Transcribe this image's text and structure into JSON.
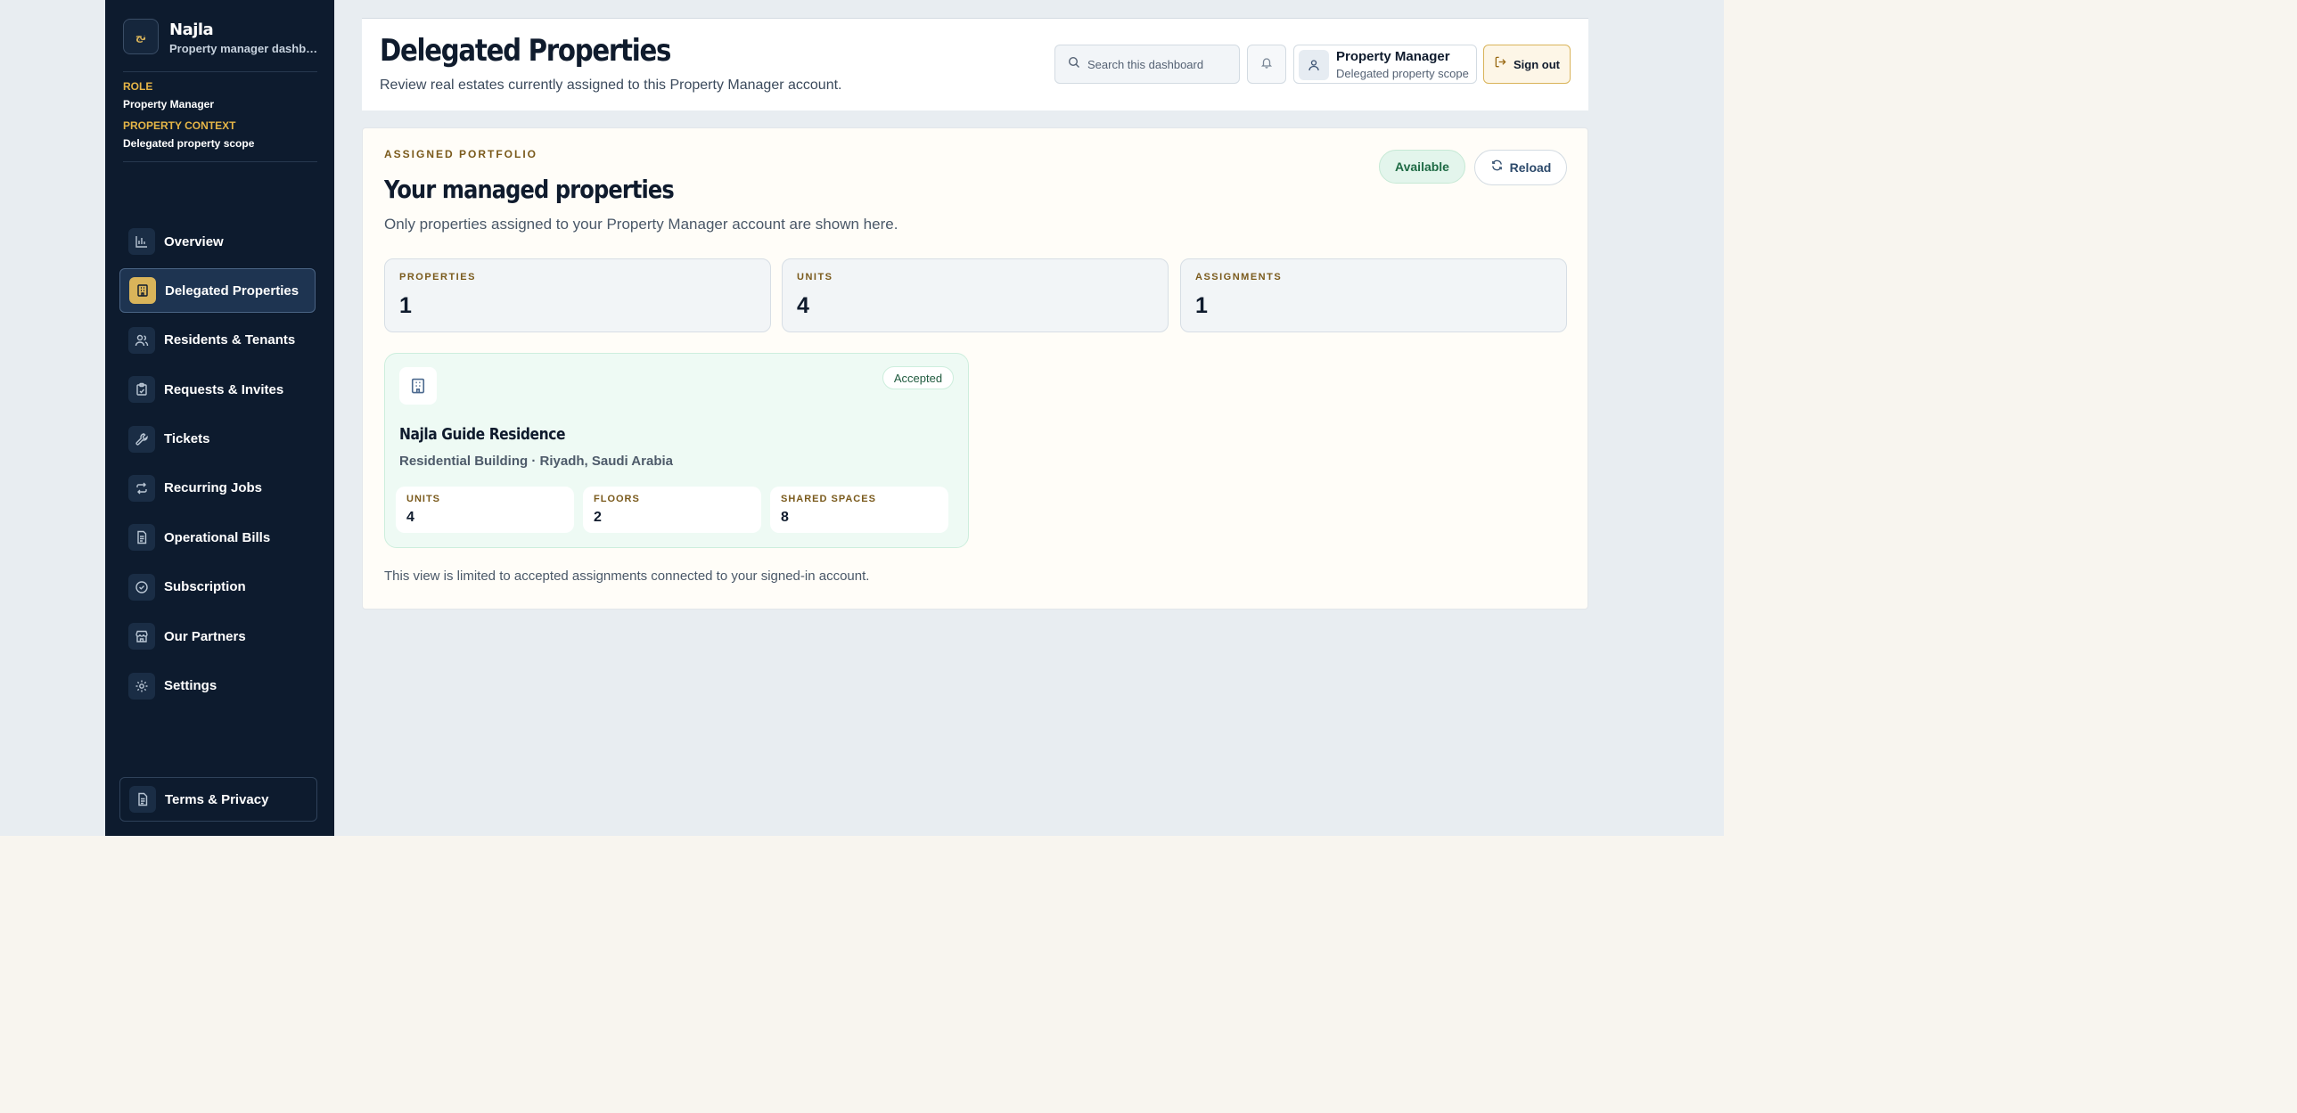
{
  "brand": {
    "logo_text": "نج",
    "name": "Najla",
    "subtitle": "Property manager dashboard"
  },
  "context": {
    "role_label": "ROLE",
    "role_value": "Property Manager",
    "property_label": "PROPERTY CONTEXT",
    "property_value": "Delegated property scope"
  },
  "sidebar": {
    "items": [
      {
        "label": "Overview",
        "icon": "chart-icon",
        "active": false
      },
      {
        "label": "Delegated Properties",
        "icon": "building-icon",
        "active": true
      },
      {
        "label": "Residents & Tenants",
        "icon": "users-icon",
        "active": false
      },
      {
        "label": "Requests & Invites",
        "icon": "clipboard-icon",
        "active": false
      },
      {
        "label": "Tickets",
        "icon": "wrench-icon",
        "active": false
      },
      {
        "label": "Recurring Jobs",
        "icon": "repeat-icon",
        "active": false
      },
      {
        "label": "Operational Bills",
        "icon": "receipt-icon",
        "active": false
      },
      {
        "label": "Subscription",
        "icon": "check-circle-icon",
        "active": false
      },
      {
        "label": "Our Partners",
        "icon": "store-icon",
        "active": false
      },
      {
        "label": "Settings",
        "icon": "gear-icon",
        "active": false
      }
    ],
    "footer_label": "Terms & Privacy"
  },
  "header": {
    "title": "Delegated Properties",
    "subtitle": "Review real estates currently assigned to this Property Manager account.",
    "search_placeholder": "Search this dashboard",
    "user_name": "Property Manager",
    "user_scope": "Delegated property scope",
    "signout_label": "Sign out"
  },
  "panel": {
    "eyebrow": "ASSIGNED PORTFOLIO",
    "title": "Your managed properties",
    "subtitle": "Only properties assigned to your Property Manager account are shown here.",
    "status_badge": "Available",
    "reload_label": "Reload",
    "stats": [
      {
        "label": "PROPERTIES",
        "value": "1"
      },
      {
        "label": "UNITS",
        "value": "4"
      },
      {
        "label": "ASSIGNMENTS",
        "value": "1"
      }
    ],
    "property": {
      "status": "Accepted",
      "name": "Najla Guide Residence",
      "meta": "Residential Building · Riyadh, Saudi Arabia",
      "metrics": [
        {
          "label": "UNITS",
          "value": "4"
        },
        {
          "label": "FLOORS",
          "value": "2"
        },
        {
          "label": "SHARED SPACES",
          "value": "8"
        }
      ]
    },
    "footnote": "This view is limited to accepted assignments connected to your signed-in account."
  },
  "colors": {
    "sidebar_bg": "#0d1b2e",
    "accent_gold": "#d9b45a",
    "success_green": "#1f6b45"
  }
}
